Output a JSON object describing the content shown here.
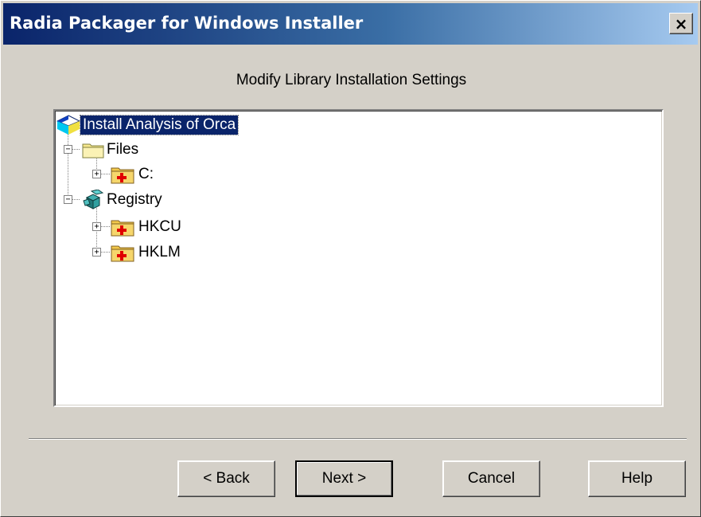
{
  "window": {
    "title": "Radia Packager for Windows Installer",
    "close_label": "×"
  },
  "heading": "Modify Library Installation Settings",
  "tree": {
    "root": "Install Analysis of Orca",
    "files": {
      "label": "Files",
      "children": [
        "C:"
      ]
    },
    "registry": {
      "label": "Registry",
      "children": [
        "HKCU",
        "HKLM"
      ]
    }
  },
  "buttons": {
    "back": "< Back",
    "next": "Next >",
    "cancel": "Cancel",
    "help": "Help"
  },
  "colors": {
    "selection": "#0a246a",
    "title_start": "#0a246a",
    "title_end": "#a6caf0",
    "face": "#d4d0c8"
  }
}
